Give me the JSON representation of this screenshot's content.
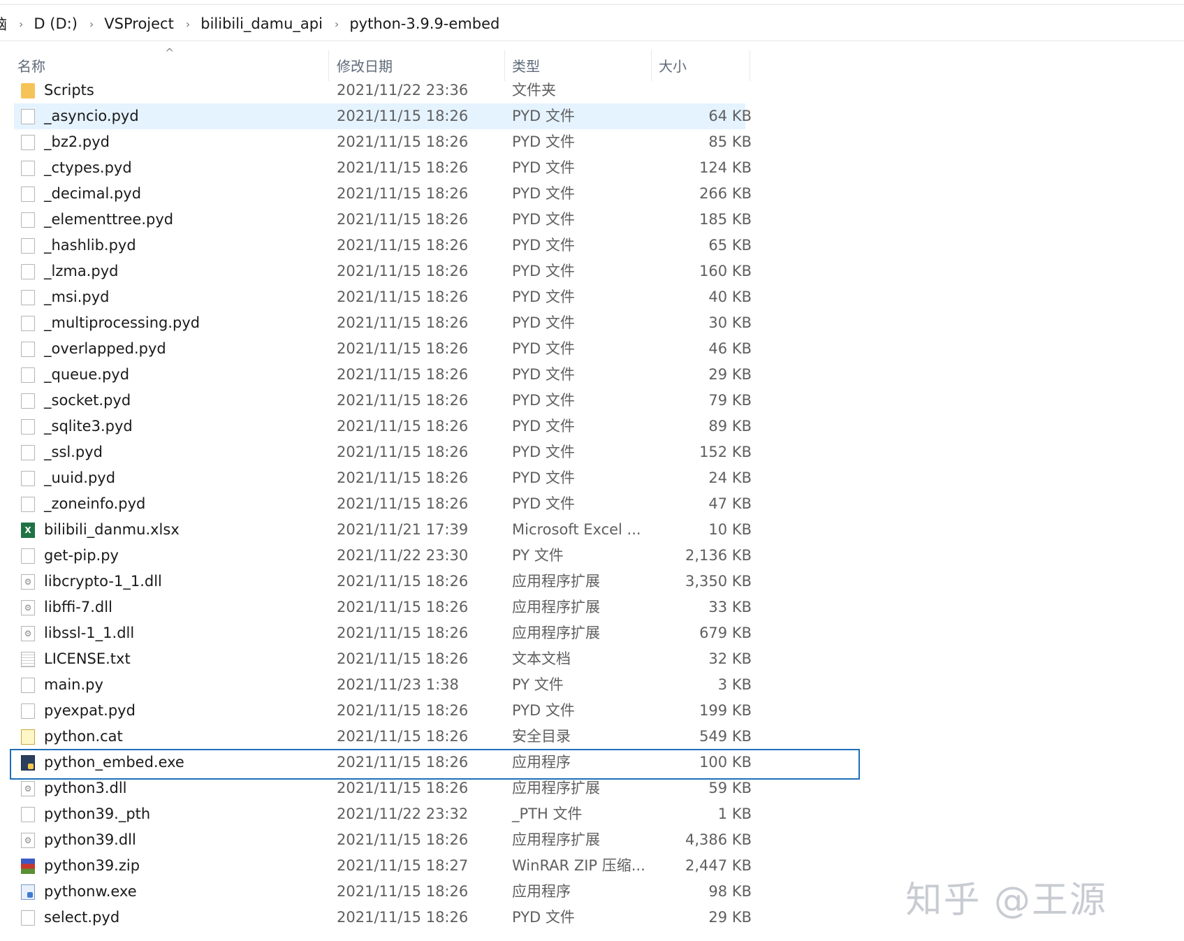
{
  "breadcrumb": {
    "root_fragment": "脑",
    "items": [
      "D (D:)",
      "VSProject",
      "bilibili_damu_api",
      "python-3.9.9-embed"
    ],
    "separator": "›"
  },
  "columns": {
    "name": "名称",
    "date": "修改日期",
    "type": "类型",
    "size": "大小"
  },
  "sort_indicator": "^",
  "files": [
    {
      "icon": "folder-icon",
      "name": "Scripts",
      "date": "2021/11/22 23:36",
      "type": "文件夹",
      "size": ""
    },
    {
      "icon": "file-icon",
      "name": "_asyncio.pyd",
      "date": "2021/11/15 18:26",
      "type": "PYD 文件",
      "size": "64 KB"
    },
    {
      "icon": "file-icon",
      "name": "_bz2.pyd",
      "date": "2021/11/15 18:26",
      "type": "PYD 文件",
      "size": "85 KB"
    },
    {
      "icon": "file-icon",
      "name": "_ctypes.pyd",
      "date": "2021/11/15 18:26",
      "type": "PYD 文件",
      "size": "124 KB"
    },
    {
      "icon": "file-icon",
      "name": "_decimal.pyd",
      "date": "2021/11/15 18:26",
      "type": "PYD 文件",
      "size": "266 KB"
    },
    {
      "icon": "file-icon",
      "name": "_elementtree.pyd",
      "date": "2021/11/15 18:26",
      "type": "PYD 文件",
      "size": "185 KB"
    },
    {
      "icon": "file-icon",
      "name": "_hashlib.pyd",
      "date": "2021/11/15 18:26",
      "type": "PYD 文件",
      "size": "65 KB"
    },
    {
      "icon": "file-icon",
      "name": "_lzma.pyd",
      "date": "2021/11/15 18:26",
      "type": "PYD 文件",
      "size": "160 KB"
    },
    {
      "icon": "file-icon",
      "name": "_msi.pyd",
      "date": "2021/11/15 18:26",
      "type": "PYD 文件",
      "size": "40 KB"
    },
    {
      "icon": "file-icon",
      "name": "_multiprocessing.pyd",
      "date": "2021/11/15 18:26",
      "type": "PYD 文件",
      "size": "30 KB"
    },
    {
      "icon": "file-icon",
      "name": "_overlapped.pyd",
      "date": "2021/11/15 18:26",
      "type": "PYD 文件",
      "size": "46 KB"
    },
    {
      "icon": "file-icon",
      "name": "_queue.pyd",
      "date": "2021/11/15 18:26",
      "type": "PYD 文件",
      "size": "29 KB"
    },
    {
      "icon": "file-icon",
      "name": "_socket.pyd",
      "date": "2021/11/15 18:26",
      "type": "PYD 文件",
      "size": "79 KB"
    },
    {
      "icon": "file-icon",
      "name": "_sqlite3.pyd",
      "date": "2021/11/15 18:26",
      "type": "PYD 文件",
      "size": "89 KB"
    },
    {
      "icon": "file-icon",
      "name": "_ssl.pyd",
      "date": "2021/11/15 18:26",
      "type": "PYD 文件",
      "size": "152 KB"
    },
    {
      "icon": "file-icon",
      "name": "_uuid.pyd",
      "date": "2021/11/15 18:26",
      "type": "PYD 文件",
      "size": "24 KB"
    },
    {
      "icon": "file-icon",
      "name": "_zoneinfo.pyd",
      "date": "2021/11/15 18:26",
      "type": "PYD 文件",
      "size": "47 KB"
    },
    {
      "icon": "excel-icon",
      "name": "bilibili_danmu.xlsx",
      "date": "2021/11/21 17:39",
      "type": "Microsoft Excel ...",
      "size": "10 KB"
    },
    {
      "icon": "file-icon",
      "name": "get-pip.py",
      "date": "2021/11/22 23:30",
      "type": "PY 文件",
      "size": "2,136 KB"
    },
    {
      "icon": "dll-icon",
      "name": "libcrypto-1_1.dll",
      "date": "2021/11/15 18:26",
      "type": "应用程序扩展",
      "size": "3,350 KB"
    },
    {
      "icon": "dll-icon",
      "name": "libffi-7.dll",
      "date": "2021/11/15 18:26",
      "type": "应用程序扩展",
      "size": "33 KB"
    },
    {
      "icon": "dll-icon",
      "name": "libssl-1_1.dll",
      "date": "2021/11/15 18:26",
      "type": "应用程序扩展",
      "size": "679 KB"
    },
    {
      "icon": "text-file-icon",
      "name": "LICENSE.txt",
      "date": "2021/11/15 18:26",
      "type": "文本文档",
      "size": "32 KB"
    },
    {
      "icon": "file-icon",
      "name": "main.py",
      "date": "2021/11/23 1:38",
      "type": "PY 文件",
      "size": "3 KB"
    },
    {
      "icon": "file-icon",
      "name": "pyexpat.pyd",
      "date": "2021/11/15 18:26",
      "type": "PYD 文件",
      "size": "199 KB"
    },
    {
      "icon": "catalog-icon",
      "name": "python.cat",
      "date": "2021/11/15 18:26",
      "type": "安全目录",
      "size": "549 KB"
    },
    {
      "icon": "python-exe-icon",
      "name": "python_embed.exe",
      "date": "2021/11/15 18:26",
      "type": "应用程序",
      "size": "100 KB"
    },
    {
      "icon": "dll-icon",
      "name": "python3.dll",
      "date": "2021/11/15 18:26",
      "type": "应用程序扩展",
      "size": "59 KB"
    },
    {
      "icon": "file-icon",
      "name": "python39._pth",
      "date": "2021/11/22 23:32",
      "type": "_PTH 文件",
      "size": "1 KB"
    },
    {
      "icon": "dll-icon",
      "name": "python39.dll",
      "date": "2021/11/15 18:26",
      "type": "应用程序扩展",
      "size": "4,386 KB"
    },
    {
      "icon": "winrar-zip-icon",
      "name": "python39.zip",
      "date": "2021/11/15 18:27",
      "type": "WinRAR ZIP 压缩...",
      "size": "2,447 KB"
    },
    {
      "icon": "pythonw-exe-icon",
      "name": "pythonw.exe",
      "date": "2021/11/15 18:26",
      "type": "应用程序",
      "size": "98 KB"
    },
    {
      "icon": "file-icon",
      "name": "select.pyd",
      "date": "2021/11/15 18:26",
      "type": "PYD 文件",
      "size": "29 KB"
    }
  ],
  "hover_row": 1,
  "selected_row": 26,
  "watermark": "知乎 @王源",
  "colors": {
    "hover": "#e5f3ff",
    "selection_border": "#1d6fb8",
    "header_text": "#5f6b7a"
  }
}
